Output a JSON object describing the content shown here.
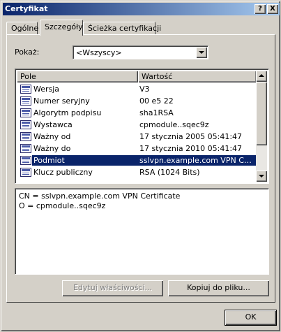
{
  "window": {
    "title": "Certyfikat",
    "help_label": "?",
    "close_label": "X"
  },
  "tabs": [
    {
      "label": "Ogólne",
      "active": false
    },
    {
      "label": "Szczegóły",
      "active": true
    },
    {
      "label": "Ścieżka certyfikacji",
      "active": false
    }
  ],
  "show": {
    "label": "Pokaż:",
    "selected": "<Wszyscy>"
  },
  "fields_list": {
    "columns": [
      "Pole",
      "Wartość"
    ],
    "rows": [
      {
        "field": "Wersja",
        "value": "V3"
      },
      {
        "field": "Numer seryjny",
        "value": "00 e5 22"
      },
      {
        "field": "Algorytm podpisu",
        "value": "sha1RSA"
      },
      {
        "field": "Wystawca",
        "value": "cpmodule..sqec9z"
      },
      {
        "field": "Ważny od",
        "value": "17 stycznia 2005 05:41:47"
      },
      {
        "field": "Ważny do",
        "value": "17 stycznia 2010 05:41:47"
      },
      {
        "field": "Podmiot",
        "value": "sslvpn.example.com VPN Certi..."
      },
      {
        "field": "Klucz publiczny",
        "value": "RSA (1024 Bits)"
      }
    ],
    "selected_index": 6
  },
  "detail": {
    "lines": [
      "CN = sslvpn.example.com VPN Certificate",
      "O = cpmodule..sqec9z"
    ]
  },
  "buttons": {
    "edit_properties": "Edytuj właściwości...",
    "copy_to_file": "Kopiuj do pliku...",
    "ok": "OK"
  }
}
